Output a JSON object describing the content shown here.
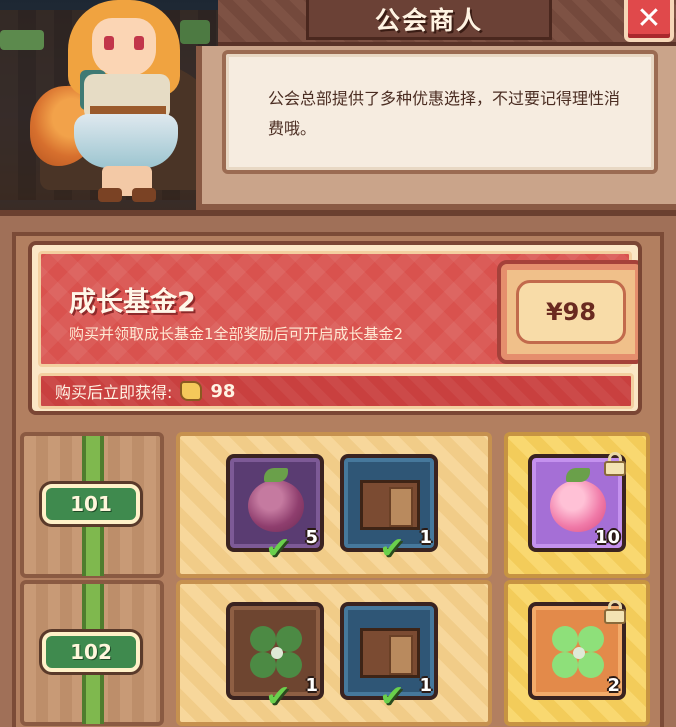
{
  "header": {
    "title": "公会商人",
    "close_icon": "close-icon"
  },
  "dialog": {
    "text": "公会总部提供了多种优惠选择，不过要记得理性消费哦。"
  },
  "fund": {
    "title": "成长基金2",
    "description": "购买并领取成长基金1全部奖励后可开启成长基金2",
    "price": "¥98",
    "reward_label": "购买后立即获得:",
    "reward_icon": "gold-coin-icon",
    "reward_value": "98"
  },
  "rows": [
    {
      "level": "101",
      "free_items": [
        {
          "icon": "purple-berry-icon",
          "qty": "5",
          "claimed": true
        },
        {
          "icon": "wood-crate-icon",
          "qty": "1",
          "claimed": true
        }
      ],
      "paid_item": {
        "icon": "pink-berry-icon",
        "qty": "10",
        "locked": true
      }
    },
    {
      "level": "102",
      "free_items": [
        {
          "icon": "four-leaf-clover-icon",
          "qty": "1",
          "claimed": true
        },
        {
          "icon": "wood-crate-icon",
          "qty": "1",
          "claimed": true
        }
      ],
      "paid_item": {
        "icon": "bright-clover-icon",
        "qty": "2",
        "locked": true
      }
    }
  ],
  "colors": {
    "accent_red": "#d9524e",
    "level_green": "#3f8a4e",
    "claimed_check": "#6ad04c"
  }
}
